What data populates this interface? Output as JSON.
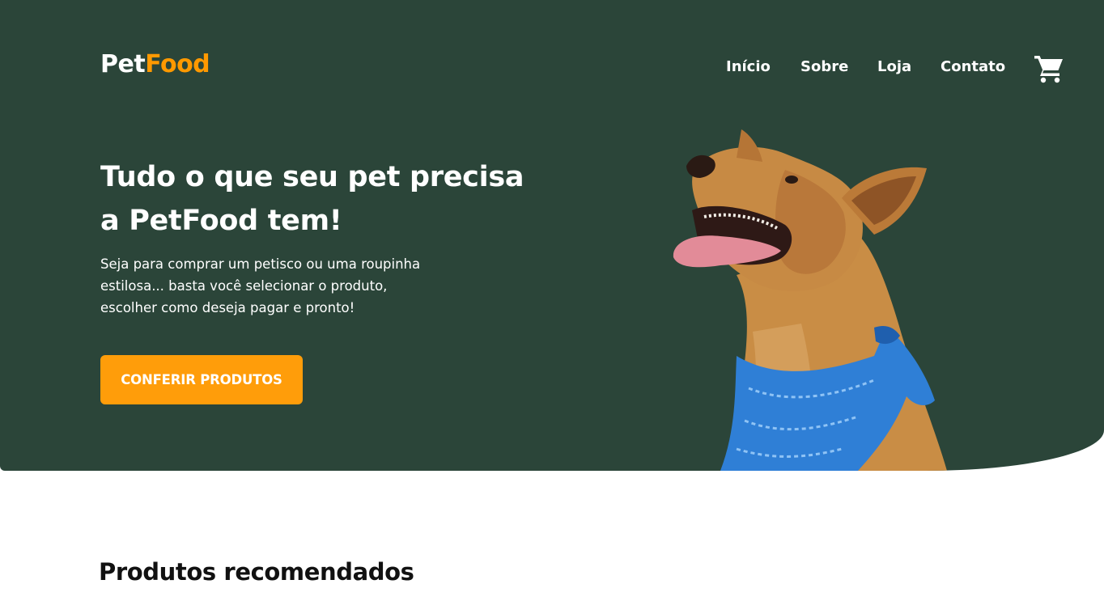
{
  "brand": {
    "part1": "Pet",
    "part2": "Food",
    "accent_color": "#ff9900"
  },
  "nav": {
    "items": [
      {
        "label": "Início"
      },
      {
        "label": "Sobre"
      },
      {
        "label": "Loja"
      },
      {
        "label": "Contato"
      }
    ],
    "cart_icon": "shopping-cart-icon"
  },
  "hero": {
    "background": "#2b4539",
    "headline_line1": "Tudo o que seu pet precisa",
    "headline_line2": "a PetFood tem!",
    "sub_line1": "Seja para comprar um petisco ou uma roupinha",
    "sub_line2": "estilosa... basta você selecionar o produto,",
    "sub_line3": "escolher como deseja pagar e pronto!",
    "cta_label": "CONFERIR PRODUTOS",
    "cta_color": "#ff9d0a",
    "image": "dog-with-blue-bandana"
  },
  "products": {
    "title": "Produtos recomendados"
  }
}
